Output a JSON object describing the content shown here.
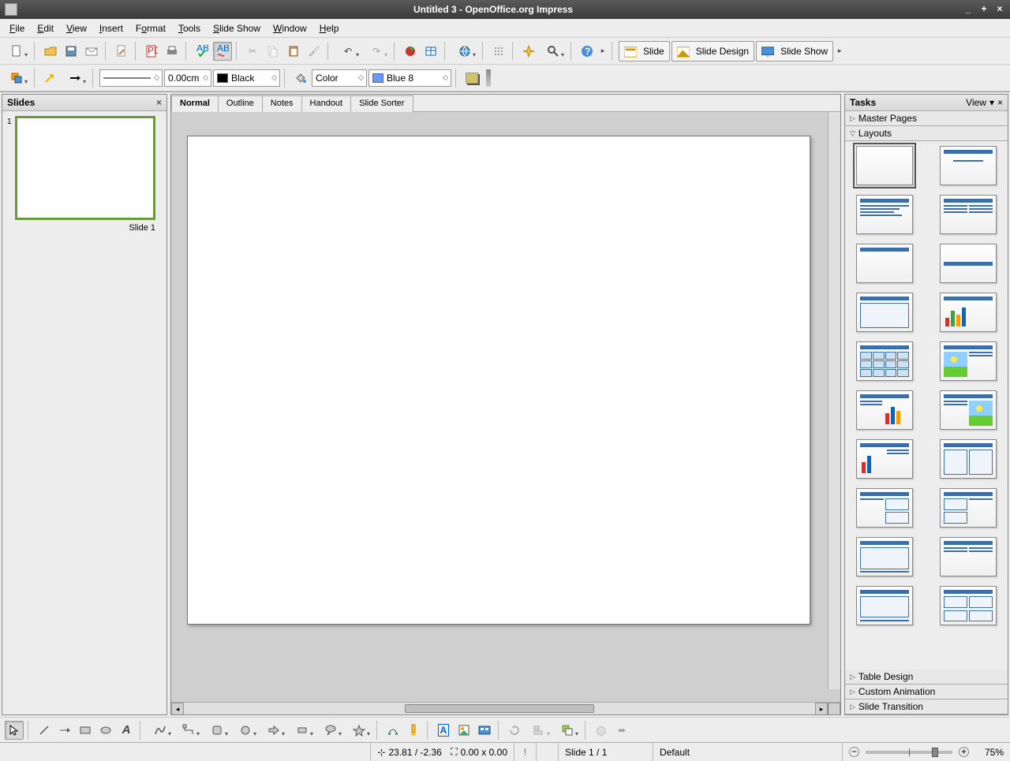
{
  "titlebar": {
    "title": "Untitled 3 - OpenOffice.org Impress"
  },
  "menu": {
    "file": "File",
    "edit": "Edit",
    "view": "View",
    "insert": "Insert",
    "format": "Format",
    "tools": "Tools",
    "slideshow": "Slide Show",
    "window": "Window",
    "help": "Help"
  },
  "toolbar1": {
    "slide": "Slide",
    "slideDesign": "Slide Design",
    "slideShow": "Slide Show"
  },
  "toolbar2": {
    "lineWidth": "0.00cm",
    "lineColor": "Black",
    "fillMode": "Color",
    "fillColor": "Blue 8",
    "lineColorHex": "#000000",
    "fillColorHex": "#6699ff",
    "shadowHex": "#d4c067"
  },
  "slidesPanel": {
    "title": "Slides",
    "slideNumber": "1",
    "slideLabel": "Slide 1"
  },
  "viewTabs": {
    "normal": "Normal",
    "outline": "Outline",
    "notes": "Notes",
    "handout": "Handout",
    "sorter": "Slide Sorter"
  },
  "tasksPanel": {
    "title": "Tasks",
    "viewLabel": "View",
    "masterPages": "Master Pages",
    "layouts": "Layouts",
    "tableDesign": "Table Design",
    "customAnimation": "Custom Animation",
    "slideTransition": "Slide Transition"
  },
  "statusbar": {
    "coords": "23.81 / -2.36",
    "size": "0.00 x 0.00",
    "slideCount": "Slide 1 / 1",
    "template": "Default",
    "zoom": "75%"
  }
}
